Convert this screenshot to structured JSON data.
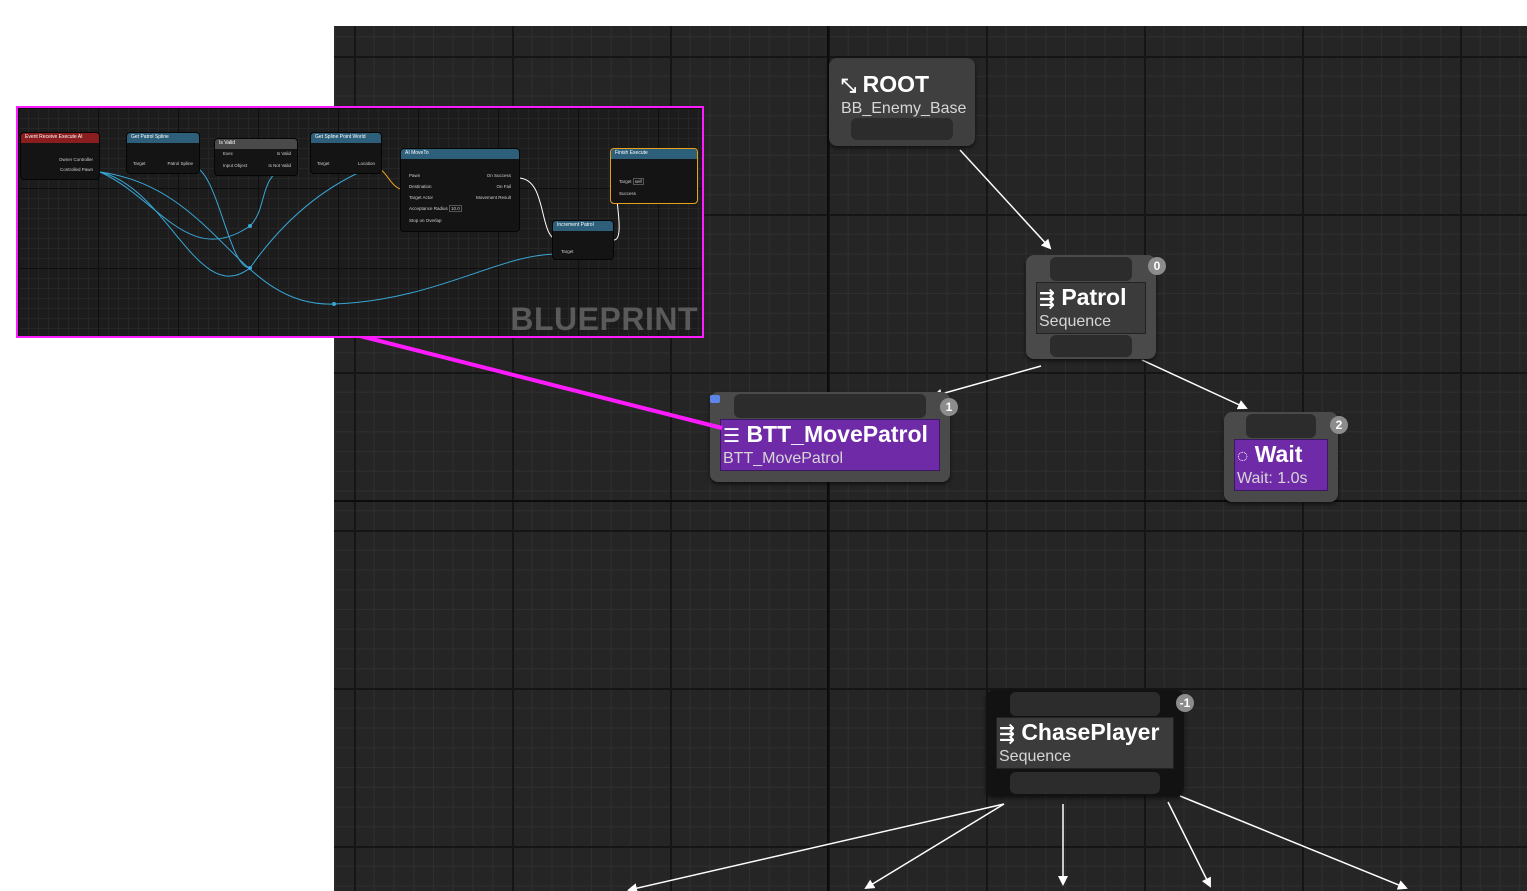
{
  "behavior_tree": {
    "root": {
      "title": "ROOT",
      "subtitle": "BB_Enemy_Base",
      "icon": "root-branch-icon"
    },
    "patrol": {
      "title": "Patrol",
      "subtitle": "Sequence",
      "index": "0",
      "icon": "sequence-icon"
    },
    "move_patrol": {
      "title": "BTT_MovePatrol",
      "subtitle": "BTT_MovePatrol",
      "index": "1",
      "icon": "task-icon",
      "color": "#6f2aa8"
    },
    "wait": {
      "title": "Wait",
      "subtitle": "Wait: 1.0s",
      "index": "2",
      "icon": "wait-icon",
      "color": "#6f2aa8"
    },
    "chase": {
      "title": "ChasePlayer",
      "subtitle": "Sequence",
      "index": "-1",
      "icon": "sequence-icon"
    }
  },
  "blueprint": {
    "watermark": "BLUEPRINT",
    "highlight_color": "#ff1bff",
    "nodes": {
      "event": {
        "header": "Event Receive Execute AI",
        "rows": [
          "Owner Controller",
          "Controlled Pawn"
        ]
      },
      "get_spline": {
        "header": "Get Patrol Spline",
        "rows": [
          "Target",
          "Patrol Spline"
        ]
      },
      "is_valid": {
        "header": "Is Valid",
        "rows": [
          "Exec",
          "Input Object",
          "Is Valid",
          "Is Not Valid"
        ]
      },
      "spline_point": {
        "header": "Get Spline Point World",
        "rows": [
          "Target",
          "Location"
        ]
      },
      "move_to": {
        "header": "AI MoveTo",
        "rows": [
          "Pawn",
          "Destination",
          "Target Actor",
          "Acceptance Radius",
          "Stop on Overlap",
          "On Success",
          "On Fail",
          "Movement Result"
        ],
        "radius_value": "10.0"
      },
      "finish": {
        "header": "Finish Execute",
        "rows": [
          "Target",
          "Success"
        ],
        "target_value": "self"
      },
      "increment": {
        "header": "Increment Patrol",
        "rows": [
          "Target"
        ]
      }
    }
  }
}
